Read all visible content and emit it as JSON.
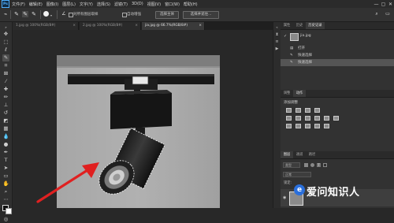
{
  "app": {
    "logo": "Ps"
  },
  "menu": [
    "文件(F)",
    "编辑(E)",
    "图像(I)",
    "图层(L)",
    "文字(Y)",
    "选择(S)",
    "滤镜(T)",
    "3D(D)",
    "视图(V)",
    "窗口(W)",
    "帮助(H)"
  ],
  "window_controls": [
    "—",
    "▢",
    "✕"
  ],
  "options": {
    "check_label": "对所有图层取样",
    "check2_label": "自动增强",
    "select_subject": "选择主体",
    "select_mask": "选择并遮住..."
  },
  "tabs": [
    {
      "label": "1.jpg @ 100%(RGB/8#)",
      "close": "×",
      "active": false
    },
    {
      "label": "2.jpg @ 100%(RGB/8#)",
      "close": "×",
      "active": false
    },
    {
      "label": "jia.jpg @ 66.7%(RGB/8#)",
      "close": "×",
      "active": true
    }
  ],
  "history_panel": {
    "tabs": [
      "属性",
      "历史",
      "历史记录"
    ],
    "snapshot": "jia.jpg",
    "items": [
      "打开",
      "快速选择",
      "快速选择"
    ]
  },
  "actions_panel": {
    "tabs": [
      "调整",
      "动作"
    ],
    "title": "添加调整"
  },
  "layers_panel": {
    "tabs": [
      "图层",
      "通道",
      "路径"
    ],
    "kind": "类型",
    "blend": "正常",
    "lock": "锁定:"
  },
  "watermark": {
    "text": "爱问知识人",
    "logo": "e"
  },
  "colors": {
    "accent": "#2a6fdb",
    "arrow": "#e02020",
    "selection": "#ffffff"
  }
}
